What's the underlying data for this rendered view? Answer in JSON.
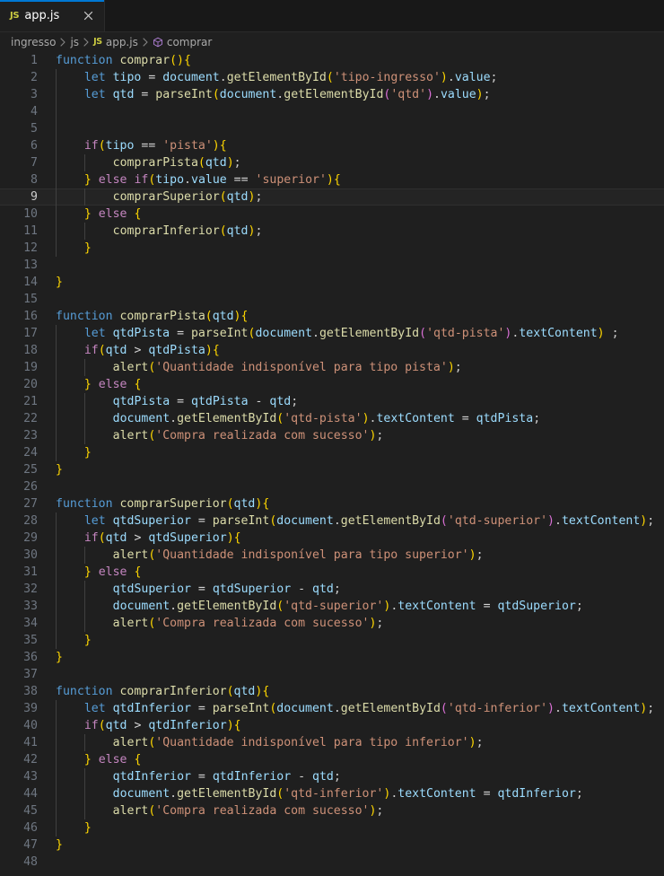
{
  "window": {
    "background": "#1f1f1f",
    "accent": "#0078d4"
  },
  "tabbar": {
    "tabs": [
      {
        "icon": "js-file-icon",
        "icon_label": "JS",
        "label": "app.js",
        "active": true,
        "close_icon": "close-icon"
      }
    ]
  },
  "breadcrumbs": {
    "items": [
      {
        "label": "ingresso",
        "icon": null
      },
      {
        "label": "js",
        "icon": null
      },
      {
        "label": "app.js",
        "icon": "js-file-icon",
        "icon_label": "JS"
      },
      {
        "label": "comprar",
        "icon": "symbol-method-icon"
      }
    ],
    "separator_icon": "chevron-right-icon"
  },
  "editor": {
    "language": "javascript",
    "current_line": 9,
    "first_line": 1,
    "last_line": 48,
    "colors": {
      "background": "#1f1f1f",
      "line_number": "#6e7681",
      "current_line_number": "#cccccc",
      "current_line_bg": "#242424",
      "keyword_control": "#c586c0",
      "keyword": "#569cd6",
      "function": "#dcdcaa",
      "variable": "#9cdcfe",
      "string": "#ce9178",
      "operator": "#d4d4d4",
      "bracket_1": "#ffd700",
      "bracket_2": "#da70d6",
      "bracket_3": "#179fff",
      "indent_guide": "#404040"
    },
    "lines": [
      {
        "n": 1,
        "text": "function comprar(){"
      },
      {
        "n": 2,
        "text": "    let tipo = document.getElementById('tipo-ingresso').value;"
      },
      {
        "n": 3,
        "text": "    let qtd = parseInt(document.getElementById('qtd').value);"
      },
      {
        "n": 4,
        "text": ""
      },
      {
        "n": 5,
        "text": ""
      },
      {
        "n": 6,
        "text": "    if(tipo == 'pista'){"
      },
      {
        "n": 7,
        "text": "        comprarPista(qtd);"
      },
      {
        "n": 8,
        "text": "    } else if(tipo.value == 'superior'){"
      },
      {
        "n": 9,
        "text": "        comprarSuperior(qtd);"
      },
      {
        "n": 10,
        "text": "    } else {"
      },
      {
        "n": 11,
        "text": "        comprarInferior(qtd);"
      },
      {
        "n": 12,
        "text": "    }"
      },
      {
        "n": 13,
        "text": ""
      },
      {
        "n": 14,
        "text": "}"
      },
      {
        "n": 15,
        "text": ""
      },
      {
        "n": 16,
        "text": "function comprarPista(qtd){"
      },
      {
        "n": 17,
        "text": "    let qtdPista = parseInt(document.getElementById('qtd-pista').textContent) ;"
      },
      {
        "n": 18,
        "text": "    if(qtd > qtdPista){"
      },
      {
        "n": 19,
        "text": "        alert('Quantidade indisponível para tipo pista');"
      },
      {
        "n": 20,
        "text": "    } else {"
      },
      {
        "n": 21,
        "text": "        qtdPista = qtdPista - qtd;"
      },
      {
        "n": 22,
        "text": "        document.getElementById('qtd-pista').textContent = qtdPista;"
      },
      {
        "n": 23,
        "text": "        alert('Compra realizada com sucesso');"
      },
      {
        "n": 24,
        "text": "    }"
      },
      {
        "n": 25,
        "text": "}"
      },
      {
        "n": 26,
        "text": ""
      },
      {
        "n": 27,
        "text": "function comprarSuperior(qtd){"
      },
      {
        "n": 28,
        "text": "    let qtdSuperior = parseInt(document.getElementById('qtd-superior').textContent);"
      },
      {
        "n": 29,
        "text": "    if(qtd > qtdSuperior){"
      },
      {
        "n": 30,
        "text": "        alert('Quantidade indisponível para tipo superior');"
      },
      {
        "n": 31,
        "text": "    } else {"
      },
      {
        "n": 32,
        "text": "        qtdSuperior = qtdSuperior - qtd;"
      },
      {
        "n": 33,
        "text": "        document.getElementById('qtd-superior').textContent = qtdSuperior;"
      },
      {
        "n": 34,
        "text": "        alert('Compra realizada com sucesso');"
      },
      {
        "n": 35,
        "text": "    }"
      },
      {
        "n": 36,
        "text": "}"
      },
      {
        "n": 37,
        "text": ""
      },
      {
        "n": 38,
        "text": "function comprarInferior(qtd){"
      },
      {
        "n": 39,
        "text": "    let qtdInferior = parseInt(document.getElementById('qtd-inferior').textContent);"
      },
      {
        "n": 40,
        "text": "    if(qtd > qtdInferior){"
      },
      {
        "n": 41,
        "text": "        alert('Quantidade indisponível para tipo inferior');"
      },
      {
        "n": 42,
        "text": "    } else {"
      },
      {
        "n": 43,
        "text": "        qtdInferior = qtdInferior - qtd;"
      },
      {
        "n": 44,
        "text": "        document.getElementById('qtd-inferior').textContent = qtdInferior;"
      },
      {
        "n": 45,
        "text": "        alert('Compra realizada com sucesso');"
      },
      {
        "n": 46,
        "text": "    }"
      },
      {
        "n": 47,
        "text": "}"
      },
      {
        "n": 48,
        "text": ""
      }
    ]
  }
}
